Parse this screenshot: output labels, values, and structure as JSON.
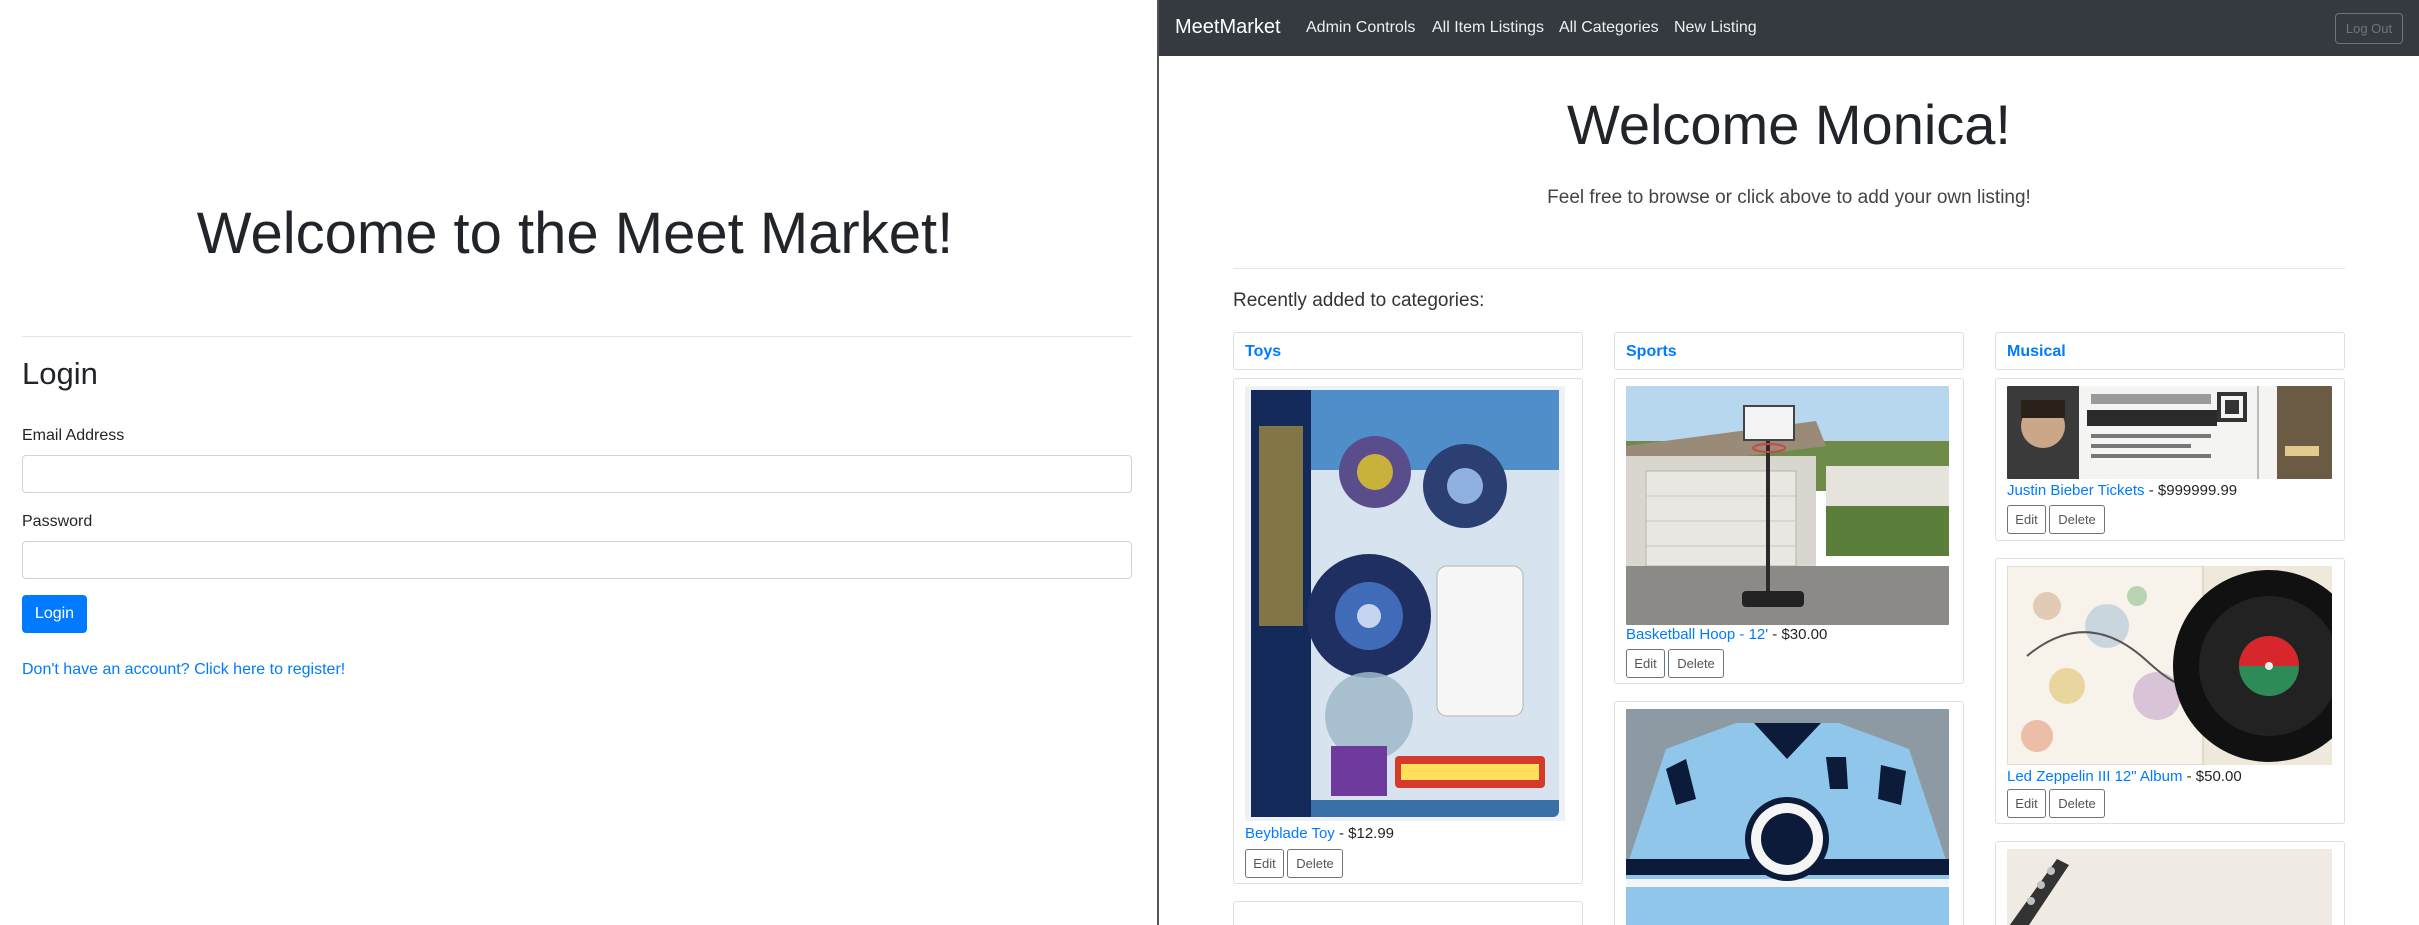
{
  "login_page": {
    "welcome": "Welcome to the Meet Market!",
    "heading": "Login",
    "email_label": "Email Address",
    "email_value": "",
    "password_label": "Password",
    "password_value": "",
    "login_button": "Login",
    "register_link": "Don't have an account? Click here to register!",
    "accent_color": "#007bff"
  },
  "navbar": {
    "brand": "MeetMarket",
    "links": [
      "Admin Controls",
      "All Item Listings",
      "All Categories",
      "New Listing"
    ],
    "logout": "Log Out",
    "background": "#343a40"
  },
  "dashboard": {
    "welcome": "Welcome Monica!",
    "lead": "Feel free to browse or click above to add your own listing!",
    "recent_label": "Recently added to categories:",
    "categories": [
      {
        "name": "Toys",
        "items": [
          {
            "title": "Beyblade Toy",
            "separator": " - ",
            "price": "$12.99",
            "edit": "Edit",
            "delete": "Delete",
            "image": "beyblade-burst-package"
          }
        ]
      },
      {
        "name": "Sports",
        "items": [
          {
            "title": "Basketball Hoop - 12'",
            "separator": " - ",
            "price": "$30.00",
            "edit": "Edit",
            "delete": "Delete",
            "image": "basketball-hoop-driveway"
          },
          {
            "title": "",
            "price": "",
            "image": "pittsburgh-penguins-jersey"
          }
        ]
      },
      {
        "name": "Musical",
        "items": [
          {
            "title": "Justin Bieber Tickets",
            "separator": " - ",
            "price": "$999999.99",
            "edit": "Edit",
            "delete": "Delete",
            "image": "believe-tour-ticket"
          },
          {
            "title": "Led Zeppelin III 12\" Album",
            "separator": " - ",
            "price": "$50.00",
            "edit": "Edit",
            "delete": "Delete",
            "image": "vinyl-record-album"
          },
          {
            "title": "",
            "price": "",
            "image": "clarinet"
          }
        ]
      }
    ]
  }
}
